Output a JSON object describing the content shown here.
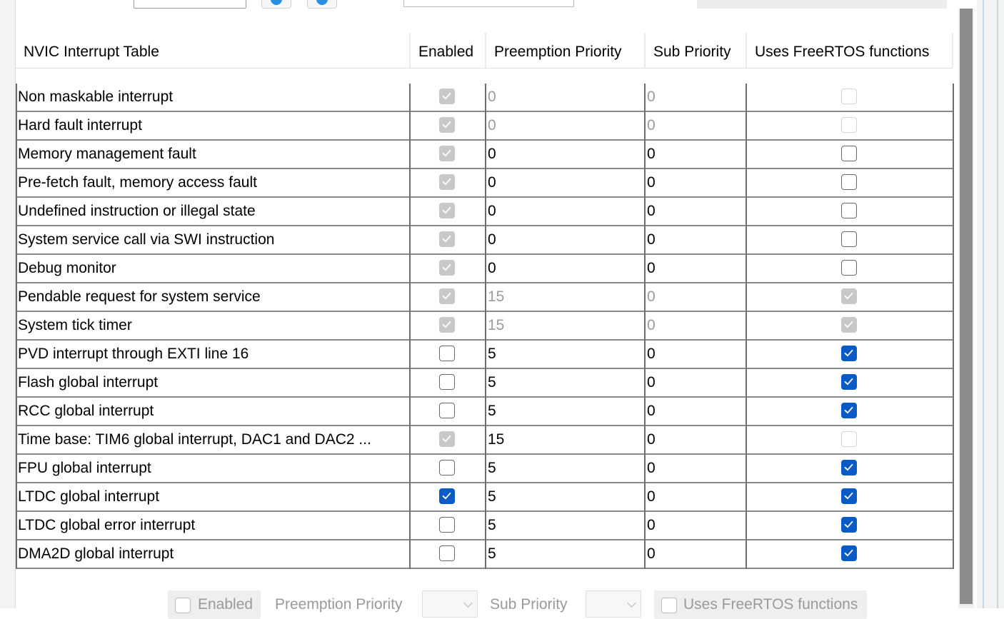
{
  "table": {
    "headers": {
      "name": "NVIC Interrupt Table",
      "enabled": "Enabled",
      "preemption": "Preemption Priority",
      "sub": "Sub Priority",
      "freertos": "Uses FreeRTOS functions"
    },
    "rows": [
      {
        "name": "Non maskable interrupt",
        "enabled": "on-disabled",
        "preemption": "0",
        "sub": "0",
        "values_grey": true,
        "freertos": "off-disabled"
      },
      {
        "name": "Hard fault interrupt",
        "enabled": "on-disabled",
        "preemption": "0",
        "sub": "0",
        "values_grey": true,
        "freertos": "off-disabled"
      },
      {
        "name": "Memory management fault",
        "enabled": "on-disabled",
        "preemption": "0",
        "sub": "0",
        "values_grey": false,
        "freertos": "off"
      },
      {
        "name": "Pre-fetch fault, memory access fault",
        "enabled": "on-disabled",
        "preemption": "0",
        "sub": "0",
        "values_grey": false,
        "freertos": "off"
      },
      {
        "name": "Undefined instruction or illegal state",
        "enabled": "on-disabled",
        "preemption": "0",
        "sub": "0",
        "values_grey": false,
        "freertos": "off"
      },
      {
        "name": "System service call via SWI instruction",
        "enabled": "on-disabled",
        "preemption": "0",
        "sub": "0",
        "values_grey": false,
        "freertos": "off"
      },
      {
        "name": "Debug monitor",
        "enabled": "on-disabled",
        "preemption": "0",
        "sub": "0",
        "values_grey": false,
        "freertos": "off"
      },
      {
        "name": "Pendable request for system service",
        "enabled": "on-disabled",
        "preemption": "15",
        "sub": "0",
        "values_grey": true,
        "freertos": "on-disabled"
      },
      {
        "name": "System tick timer",
        "enabled": "on-disabled",
        "preemption": "15",
        "sub": "0",
        "values_grey": true,
        "freertos": "on-disabled"
      },
      {
        "name": "PVD interrupt through EXTI line 16",
        "enabled": "off",
        "preemption": "5",
        "sub": "0",
        "values_grey": false,
        "freertos": "on"
      },
      {
        "name": "Flash global interrupt",
        "enabled": "off",
        "preemption": "5",
        "sub": "0",
        "values_grey": false,
        "freertos": "on"
      },
      {
        "name": "RCC global interrupt",
        "enabled": "off",
        "preemption": "5",
        "sub": "0",
        "values_grey": false,
        "freertos": "on"
      },
      {
        "name": "Time base: TIM6 global interrupt, DAC1 and DAC2 ...",
        "enabled": "on-disabled",
        "preemption": "15",
        "sub": "0",
        "values_grey": false,
        "freertos": "off-disabled"
      },
      {
        "name": "FPU global interrupt",
        "enabled": "off",
        "preemption": "5",
        "sub": "0",
        "values_grey": false,
        "freertos": "on"
      },
      {
        "name": "LTDC global interrupt",
        "enabled": "on",
        "preemption": "5",
        "sub": "0",
        "values_grey": false,
        "freertos": "on"
      },
      {
        "name": "LTDC global error interrupt",
        "enabled": "off",
        "preemption": "5",
        "sub": "0",
        "values_grey": false,
        "freertos": "on"
      },
      {
        "name": "DMA2D global interrupt",
        "enabled": "off",
        "preemption": "5",
        "sub": "0",
        "values_grey": false,
        "freertos": "on"
      }
    ]
  },
  "bottom": {
    "enabled_label": "Enabled",
    "preemption_label": "Preemption Priority",
    "sub_label": "Sub Priority",
    "freertos_label": "Uses FreeRTOS functions"
  },
  "colors": {
    "accent": "#0a5bc6",
    "disabled_check": "#c8c8c8",
    "grid": "#6e6e6e",
    "scroll_thumb": "#8b8b8b"
  }
}
